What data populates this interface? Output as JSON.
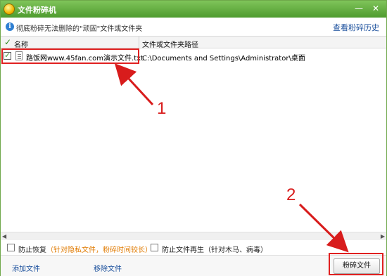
{
  "window": {
    "title": "文件粉碎机",
    "minimize_glyph": "—",
    "close_glyph": "✕"
  },
  "infobar": {
    "text": "彻底粉碎无法删除的\"顽固\"文件或文件夹",
    "history_link": "查看粉碎历史"
  },
  "list": {
    "columns": [
      "名称",
      "文件或文件夹路径"
    ],
    "rows": [
      {
        "checked": true,
        "name": "路饭网www.45fan.com演示文件.txt",
        "path": "C:\\Documents and Settings\\Administrator\\桌面"
      }
    ]
  },
  "options": {
    "prevent_recovery": "防止恢复",
    "prevent_recovery_hint": "（针对隐私文件，粉碎时间较长）",
    "prevent_regen": "防止文件再生",
    "prevent_regen_hint": "（针对木马、病毒）"
  },
  "footer": {
    "add_file": "添加文件",
    "remove_file": "移除文件",
    "shred_button": "粉碎文件"
  },
  "annotations": {
    "label_1": "1",
    "label_2": "2",
    "color": "#d81c1c"
  },
  "colors": {
    "titlebar": "#5aa83a",
    "link": "#1a4f9c",
    "hint": "#e07a00"
  }
}
